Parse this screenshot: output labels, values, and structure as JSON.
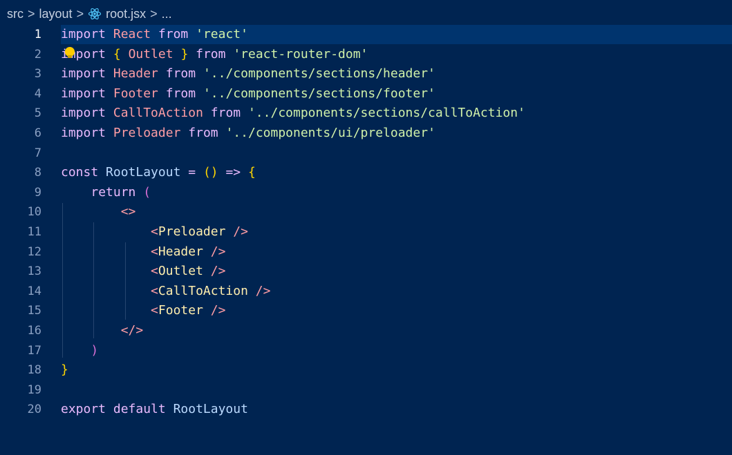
{
  "breadcrumb": {
    "items": [
      "src",
      "layout",
      "root.jsx",
      "..."
    ],
    "separator": ">",
    "file_icon": "react-icon"
  },
  "editor": {
    "current_line": 1,
    "lines": [
      {
        "n": "1",
        "tokens": [
          [
            "kw",
            "import"
          ],
          [
            "pl",
            " "
          ],
          [
            "id",
            "React"
          ],
          [
            "pl",
            " "
          ],
          [
            "kw",
            "from"
          ],
          [
            "pl",
            " "
          ],
          [
            "str",
            "'react'"
          ]
        ]
      },
      {
        "n": "2",
        "tokens": [
          [
            "kw",
            "import"
          ],
          [
            "pl",
            " "
          ],
          [
            "br1",
            "{"
          ],
          [
            "pl",
            " "
          ],
          [
            "id",
            "Outlet"
          ],
          [
            "pl",
            " "
          ],
          [
            "br1",
            "}"
          ],
          [
            "pl",
            " "
          ],
          [
            "kw",
            "from"
          ],
          [
            "pl",
            " "
          ],
          [
            "str",
            "'react-router-dom'"
          ]
        ]
      },
      {
        "n": "3",
        "tokens": [
          [
            "kw",
            "import"
          ],
          [
            "pl",
            " "
          ],
          [
            "id",
            "Header"
          ],
          [
            "pl",
            " "
          ],
          [
            "kw",
            "from"
          ],
          [
            "pl",
            " "
          ],
          [
            "str",
            "'../components/sections/header'"
          ]
        ]
      },
      {
        "n": "4",
        "tokens": [
          [
            "kw",
            "import"
          ],
          [
            "pl",
            " "
          ],
          [
            "id",
            "Footer"
          ],
          [
            "pl",
            " "
          ],
          [
            "kw",
            "from"
          ],
          [
            "pl",
            " "
          ],
          [
            "str",
            "'../components/sections/footer'"
          ]
        ]
      },
      {
        "n": "5",
        "tokens": [
          [
            "kw",
            "import"
          ],
          [
            "pl",
            " "
          ],
          [
            "id",
            "CallToAction"
          ],
          [
            "pl",
            " "
          ],
          [
            "kw",
            "from"
          ],
          [
            "pl",
            " "
          ],
          [
            "str",
            "'../components/sections/callToAction'"
          ]
        ]
      },
      {
        "n": "6",
        "tokens": [
          [
            "kw",
            "import"
          ],
          [
            "pl",
            " "
          ],
          [
            "id",
            "Preloader"
          ],
          [
            "pl",
            " "
          ],
          [
            "kw",
            "from"
          ],
          [
            "pl",
            " "
          ],
          [
            "str",
            "'../components/ui/preloader'"
          ]
        ]
      },
      {
        "n": "7",
        "tokens": []
      },
      {
        "n": "8",
        "tokens": [
          [
            "kw",
            "const"
          ],
          [
            "pl",
            " "
          ],
          [
            "fn",
            "RootLayout"
          ],
          [
            "pl",
            " "
          ],
          [
            "kw",
            "="
          ],
          [
            "pl",
            " "
          ],
          [
            "br1",
            "()"
          ],
          [
            "pl",
            " "
          ],
          [
            "kw",
            "=>"
          ],
          [
            "pl",
            " "
          ],
          [
            "br1",
            "{"
          ]
        ]
      },
      {
        "n": "9",
        "tokens": [
          [
            "pl",
            "    "
          ],
          [
            "kw",
            "return"
          ],
          [
            "pl",
            " "
          ],
          [
            "br2",
            "("
          ]
        ]
      },
      {
        "n": "10",
        "tokens": [
          [
            "pl",
            "        "
          ],
          [
            "tagb",
            "<>"
          ]
        ]
      },
      {
        "n": "11",
        "tokens": [
          [
            "pl",
            "            "
          ],
          [
            "tagb",
            "<"
          ],
          [
            "tagn",
            "Preloader"
          ],
          [
            "pl",
            " "
          ],
          [
            "tagb",
            "/>"
          ]
        ]
      },
      {
        "n": "12",
        "tokens": [
          [
            "pl",
            "            "
          ],
          [
            "tagb",
            "<"
          ],
          [
            "tagn",
            "Header"
          ],
          [
            "pl",
            " "
          ],
          [
            "tagb",
            "/>"
          ]
        ]
      },
      {
        "n": "13",
        "tokens": [
          [
            "pl",
            "            "
          ],
          [
            "tagb",
            "<"
          ],
          [
            "tagn",
            "Outlet"
          ],
          [
            "pl",
            " "
          ],
          [
            "tagb",
            "/>"
          ]
        ]
      },
      {
        "n": "14",
        "tokens": [
          [
            "pl",
            "            "
          ],
          [
            "tagb",
            "<"
          ],
          [
            "tagn",
            "CallToAction"
          ],
          [
            "pl",
            " "
          ],
          [
            "tagb",
            "/>"
          ]
        ]
      },
      {
        "n": "15",
        "tokens": [
          [
            "pl",
            "            "
          ],
          [
            "tagb",
            "<"
          ],
          [
            "tagn",
            "Footer"
          ],
          [
            "pl",
            " "
          ],
          [
            "tagb",
            "/>"
          ]
        ]
      },
      {
        "n": "16",
        "tokens": [
          [
            "pl",
            "        "
          ],
          [
            "tagb",
            "</>"
          ]
        ]
      },
      {
        "n": "17",
        "tokens": [
          [
            "pl",
            "    "
          ],
          [
            "br2",
            ")"
          ]
        ]
      },
      {
        "n": "18",
        "tokens": [
          [
            "br1",
            "}"
          ]
        ]
      },
      {
        "n": "19",
        "tokens": []
      },
      {
        "n": "20",
        "tokens": [
          [
            "kw",
            "export"
          ],
          [
            "pl",
            " "
          ],
          [
            "kw",
            "default"
          ],
          [
            "pl",
            " "
          ],
          [
            "fn",
            "RootLayout"
          ]
        ]
      }
    ]
  }
}
